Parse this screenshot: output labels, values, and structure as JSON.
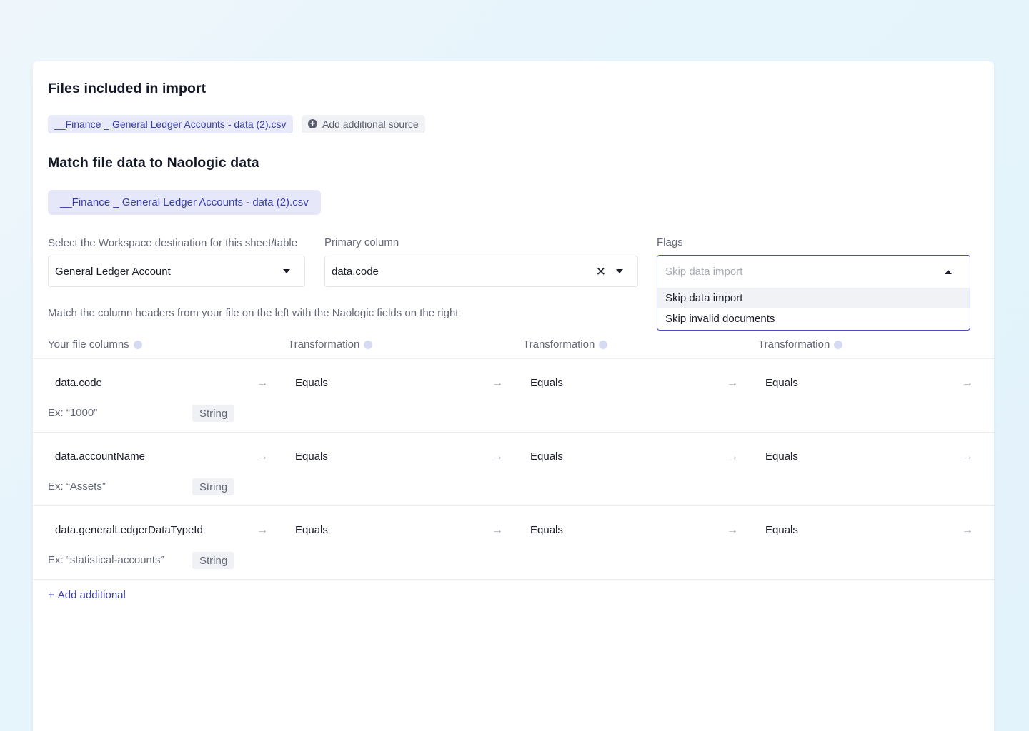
{
  "files_section": {
    "title": "Files included in import",
    "file_chip": "__Finance _ General Ledger Accounts - data (2).csv",
    "add_source_label": "Add additional source"
  },
  "match_section": {
    "title": "Match file data to Naologic data",
    "active_file": "__Finance _ General Ledger Accounts - data (2).csv"
  },
  "destination": {
    "label": "Select the Workspace destination for this sheet/table",
    "value": "General Ledger Account"
  },
  "primary_column": {
    "label": "Primary column",
    "value": "data.code"
  },
  "flags": {
    "label": "Flags",
    "placeholder": "Skip data import",
    "options": [
      "Skip data import",
      "Skip invalid documents"
    ]
  },
  "hint": "Match the column headers from your file on the left with the Naologic fields on the right",
  "columns": {
    "file_columns": "Your file columns",
    "transformation_1": "Transformation",
    "transformation_2": "Transformation",
    "transformation_3": "Transformation"
  },
  "rows": [
    {
      "field": "data.code",
      "example": "Ex: “1000”",
      "type": "String",
      "t1": "Equals",
      "t2": "Equals",
      "t3": "Equals"
    },
    {
      "field": "data.accountName",
      "example": "Ex: “Assets”",
      "type": "String",
      "t1": "Equals",
      "t2": "Equals",
      "t3": "Equals"
    },
    {
      "field": "data.generalLedgerDataTypeId",
      "example": "Ex: “statistical-accounts”",
      "type": "String",
      "t1": "Equals",
      "t2": "Equals",
      "t3": "Equals"
    }
  ],
  "add_additional": "Add additional",
  "add_additional_icon": "+",
  "colors": {
    "accent": "#3a40a6",
    "chip_bg": "#e8eaf9",
    "focus_border": "#4b50b8"
  }
}
